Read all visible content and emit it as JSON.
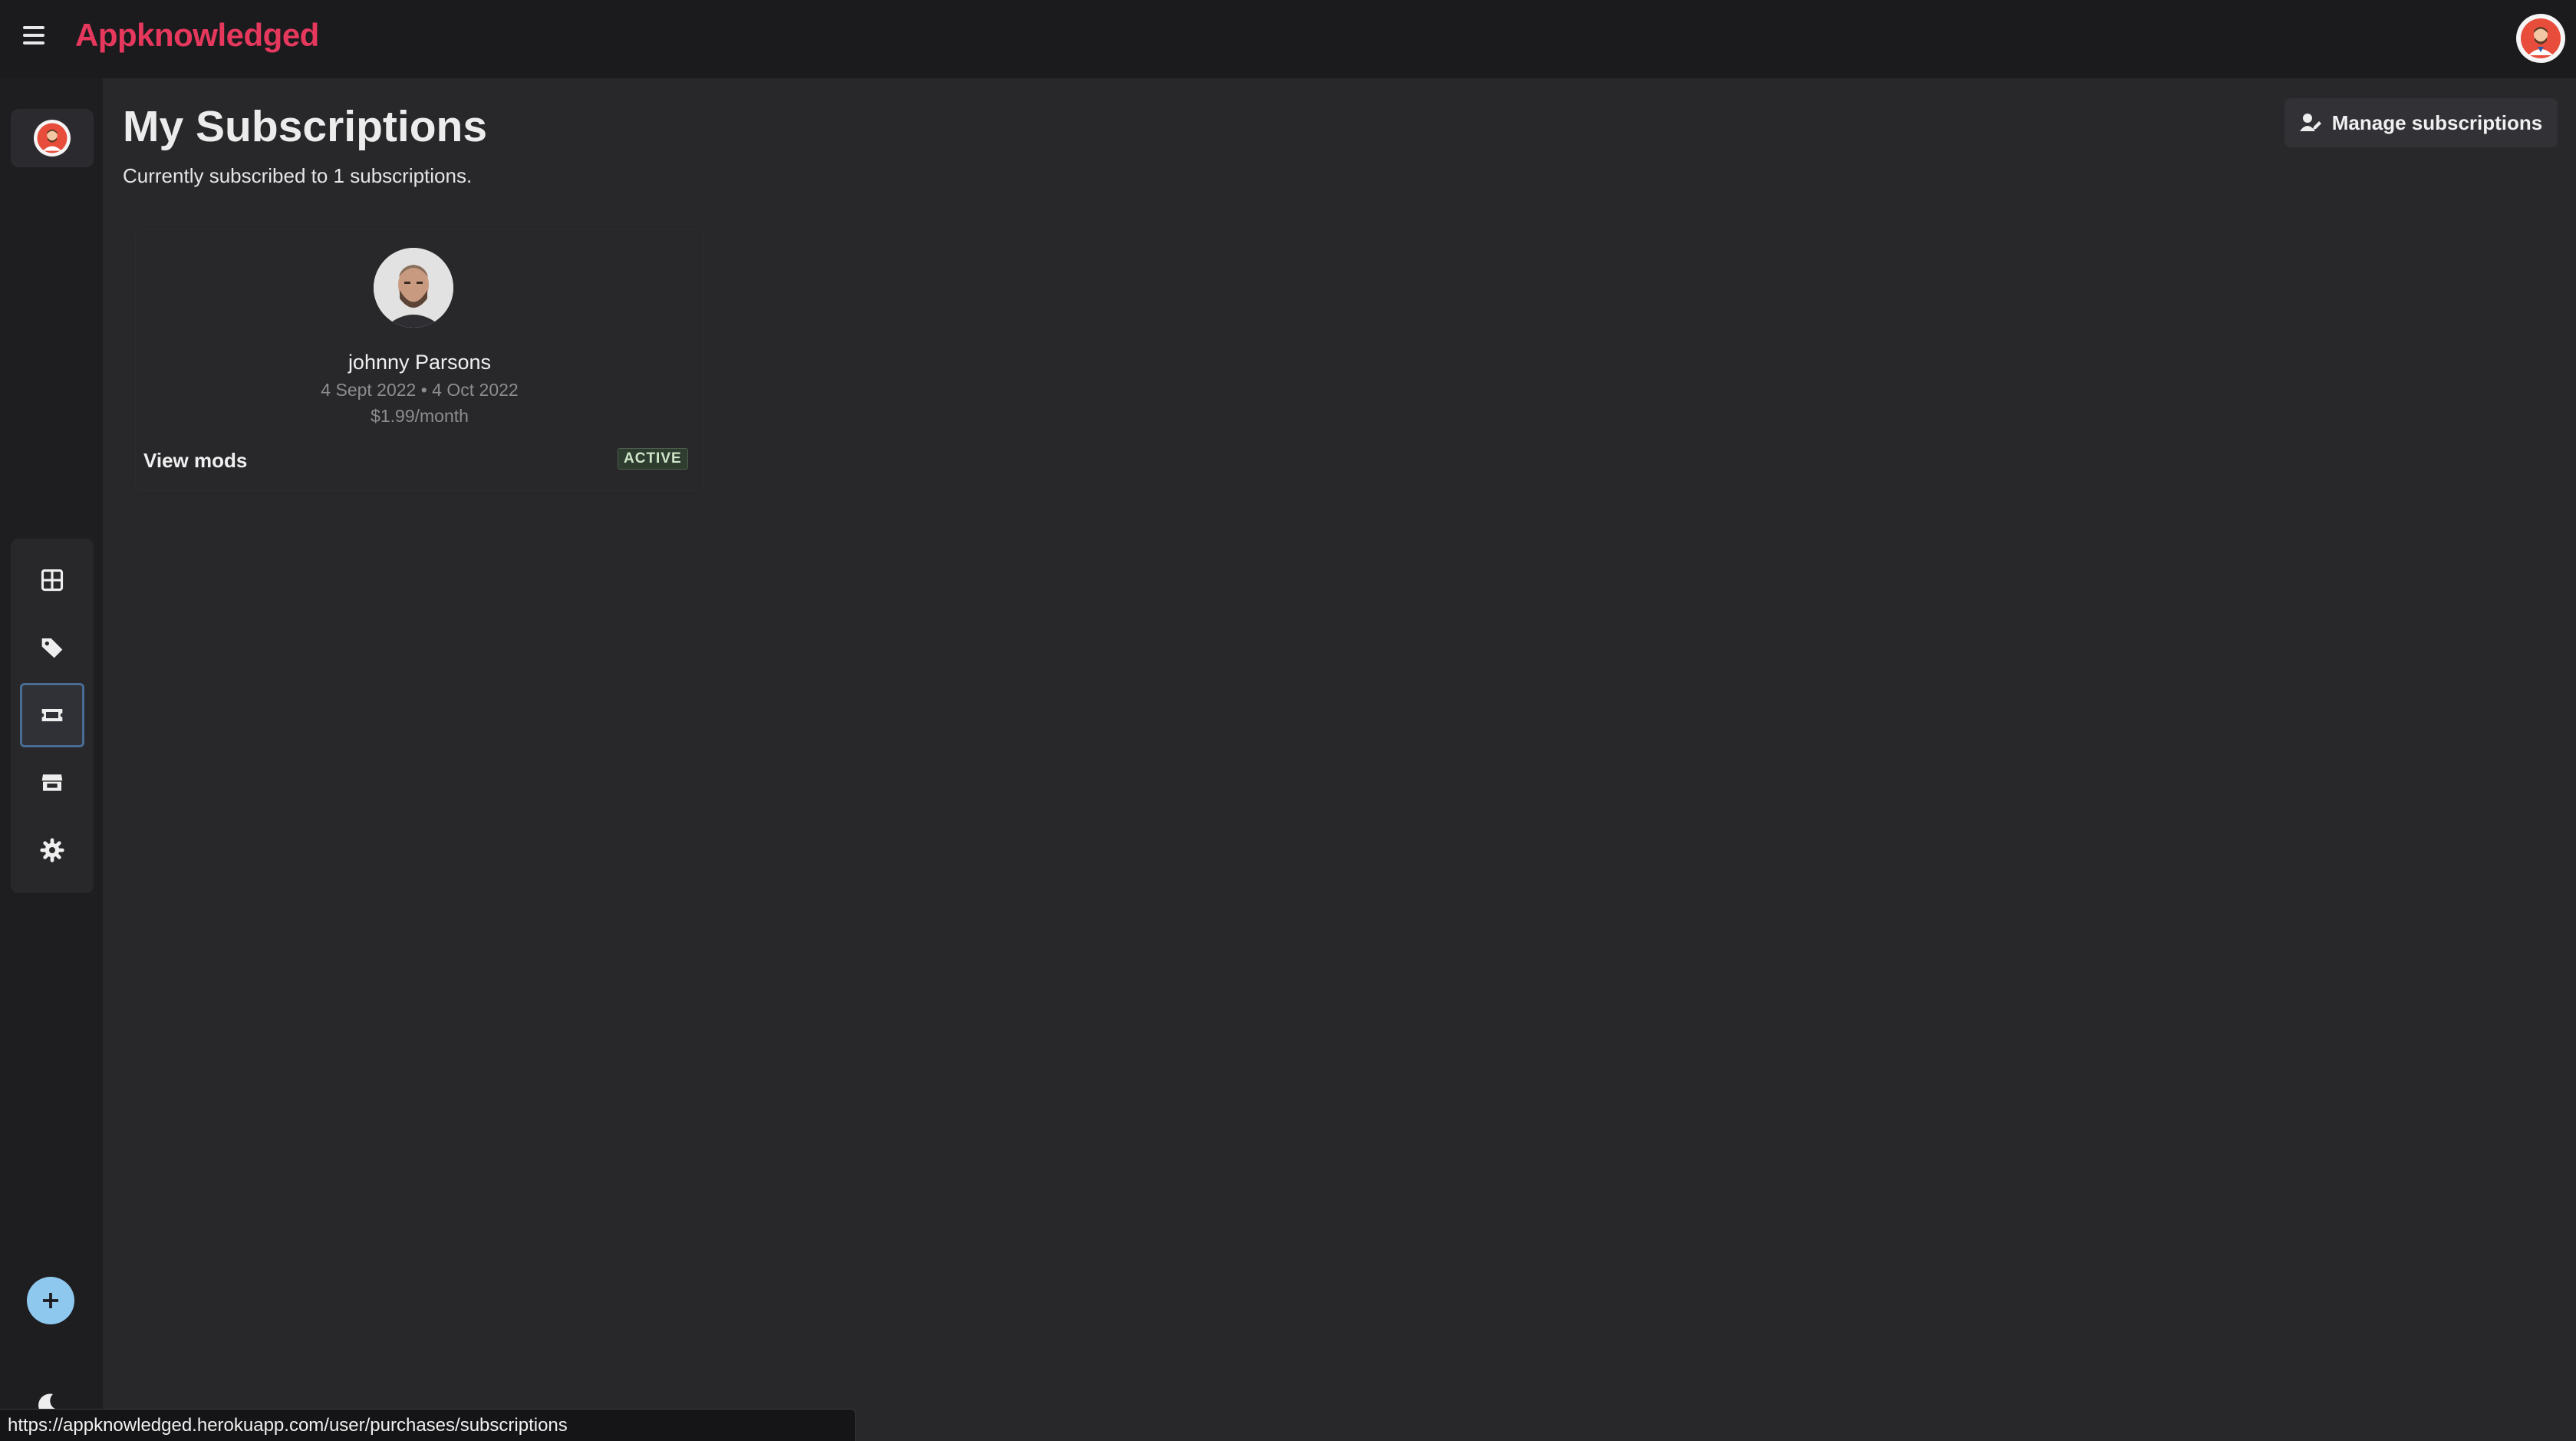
{
  "brand": {
    "name": "Appknowledged",
    "color": "#e6385d"
  },
  "header": {
    "menu_icon": "hamburger-icon",
    "avatar_icon": "user-avatar-icon"
  },
  "sidebar": {
    "items": [
      {
        "name": "dashboard",
        "icon": "grid-icon",
        "active": false
      },
      {
        "name": "tags",
        "icon": "tag-icon",
        "active": false
      },
      {
        "name": "subscriptions",
        "icon": "ticket-icon",
        "active": true
      },
      {
        "name": "store",
        "icon": "storefront-icon",
        "active": false
      },
      {
        "name": "settings",
        "icon": "gear-icon",
        "active": false
      }
    ],
    "add_icon": "plus-icon",
    "theme_icon": "moon-icon"
  },
  "main": {
    "title": "My Subscriptions",
    "subtitle": "Currently subscribed to 1 subscriptions.",
    "manage_label": "Manage subscriptions"
  },
  "subscription": {
    "name": "johnny Parsons",
    "dates": "4 Sept 2022 • 4 Oct 2022",
    "price": "$1.99/month",
    "action": "View mods",
    "status": "ACTIVE"
  },
  "status_url": "https://appknowledged.herokuapp.com/user/purchases/subscriptions",
  "colors": {
    "background": "#28282b",
    "sidebar": "#1e1e21",
    "active_border": "#4a6c94",
    "add_button": "#8ec8ee"
  }
}
